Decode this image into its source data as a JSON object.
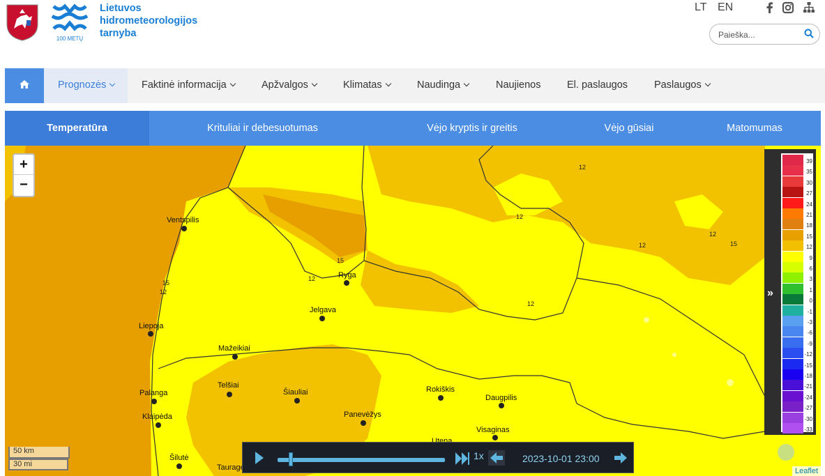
{
  "header": {
    "org_name_lines": [
      "Lietuvos",
      "hidrometeorologijos",
      "tarnyba"
    ],
    "logo_caption": "100 METŲ",
    "languages": [
      "LT",
      "EN"
    ],
    "social_icons": [
      "facebook-icon",
      "instagram-icon",
      "sitemap-icon"
    ],
    "search_placeholder": "Paieška..."
  },
  "nav": {
    "items": [
      {
        "label": "Prognozės",
        "dropdown": true,
        "active": true
      },
      {
        "label": "Faktinė informacija",
        "dropdown": true
      },
      {
        "label": "Apžvalgos",
        "dropdown": true
      },
      {
        "label": "Klimatas",
        "dropdown": true
      },
      {
        "label": "Naudinga",
        "dropdown": true
      },
      {
        "label": "Naujienos",
        "dropdown": false
      },
      {
        "label": "El. paslaugos",
        "dropdown": false
      },
      {
        "label": "Paslaugos",
        "dropdown": true
      }
    ]
  },
  "tabs": [
    "Temperatūra",
    "Krituliai ir debesuotumas",
    "Vėjo kryptis ir greitis",
    "Vėjo gūsiai",
    "Matomumas"
  ],
  "map": {
    "zoom_in": "+",
    "zoom_out": "−",
    "cities": [
      "Ventspilis",
      "Ryga",
      "Jelgava",
      "Liepoja",
      "Mažeikiai",
      "Telšiai",
      "Šiauliai",
      "Rokiškis",
      "Daugpilis",
      "Palanga",
      "Klaipėda",
      "Panevėžys",
      "Visaginas",
      "Utena",
      "Šilutė",
      "Tauragė"
    ],
    "contour_labels": [
      "12",
      "12",
      "15",
      "12",
      "12",
      "12",
      "12",
      "15",
      "12",
      "12",
      "15"
    ],
    "scale_km": "50 km",
    "scale_mi": "30 mi",
    "attribution": "Leaflet"
  },
  "legend": {
    "ticks": [
      "39",
      "35",
      "30",
      "27",
      "24",
      "21",
      "18",
      "15",
      "12",
      "9",
      "6",
      "3",
      "1",
      "0",
      "-1",
      "-3",
      "-6",
      "-9",
      "-12",
      "-15",
      "-18",
      "-21",
      "-24",
      "-27",
      "-30",
      "-33"
    ],
    "colors": [
      "#e0284a",
      "#e8304a",
      "#e83a3a",
      "#b81414",
      "#ff1a1a",
      "#ff7a00",
      "#e08010",
      "#e8a000",
      "#f2c000",
      "#ffff00",
      "#d6ff00",
      "#8ff000",
      "#2fbf2f",
      "#0a7a3a",
      "#20b0a0",
      "#5aa0f0",
      "#4a86f0",
      "#3a6ef0",
      "#2a4ef0",
      "#1a2af0",
      "#1a00f0",
      "#4a10d8",
      "#6a10d0",
      "#7a20c8",
      "#9a40e0",
      "#b050f0"
    ]
  },
  "player": {
    "speed": "1x",
    "datetime": "2023-10-01 23:00",
    "progress": 0.08
  },
  "colors": {
    "accent": "#4a8de3",
    "accent_dark": "#3b7dd8",
    "brand_text": "#1a7fd4"
  }
}
